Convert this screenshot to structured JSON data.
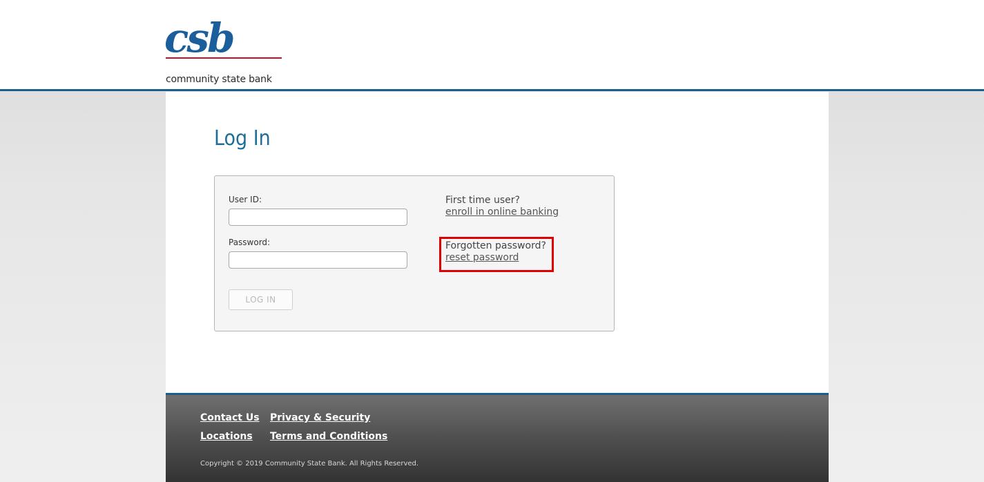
{
  "brand": {
    "logo_mark": "csb",
    "logo_text": "community state bank",
    "accent_color": "#1a5e8c",
    "logo_line_color": "#c8102e"
  },
  "login": {
    "title": "Log In",
    "user_id_label": "User ID:",
    "user_id_value": "",
    "password_label": "Password:",
    "password_value": "",
    "submit_label": "LOG IN"
  },
  "sidebar": {
    "first_time_heading": "First time user?",
    "enroll_link": "enroll in online banking",
    "forgot_heading": "Forgotten password?",
    "reset_link": "reset password",
    "highlight_color": "#e00000"
  },
  "footer": {
    "links": [
      "Contact Us",
      "Privacy & Security",
      "Locations",
      "Terms and Conditions"
    ],
    "copyright": "Copyright © 2019 Community State Bank. All Rights Reserved."
  }
}
